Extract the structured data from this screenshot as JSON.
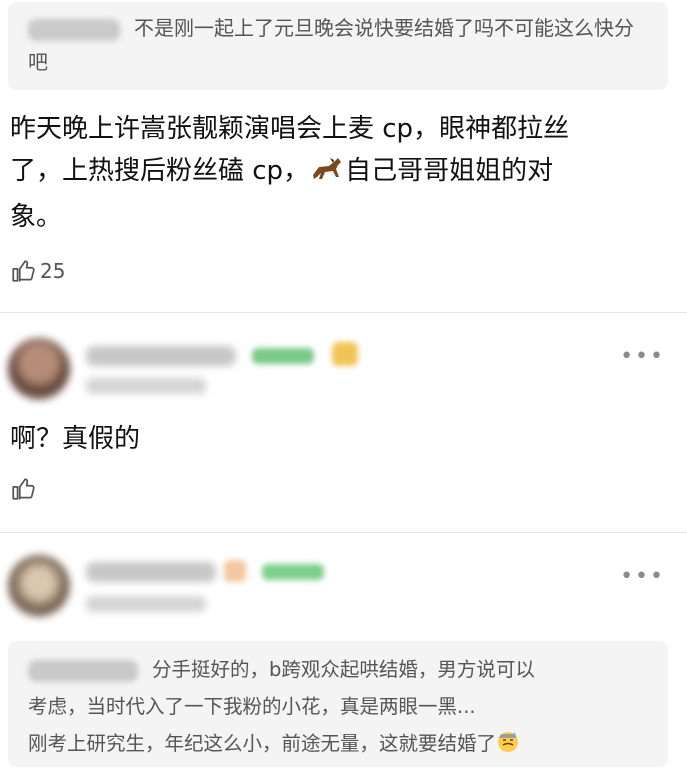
{
  "reply1": {
    "quote_text": "不是刚一起上了元旦晚会说快要结婚了吗不可能这么快分吧"
  },
  "main_comment": {
    "line1": "昨天晚上许嵩张靓颖演唱会上麦 cp，眼神都拉丝",
    "line2_a": "了，上热搜后粉丝磕 cp，",
    "line2_b": "自己哥哥姐姐的对",
    "line3": "象。",
    "like_count": "25"
  },
  "comment2": {
    "text": "啊？真假的",
    "more_label": "•••"
  },
  "comment3": {
    "more_label": "•••",
    "quote_line1": "分手挺好的，b跨观众起哄结婚，男方说可以",
    "quote_line2": "考虑，当时代入了一下我粉的小花，真是两眼一黑...",
    "quote_line3": "刚考上研究生，年纪这么小，前途无量，这就要结婚了"
  },
  "icons": {
    "like": "thumbs-up-icon",
    "horse": "horse-emoji-icon",
    "sweat": "sweat-face-emoji-icon",
    "more": "more-dots-icon"
  }
}
